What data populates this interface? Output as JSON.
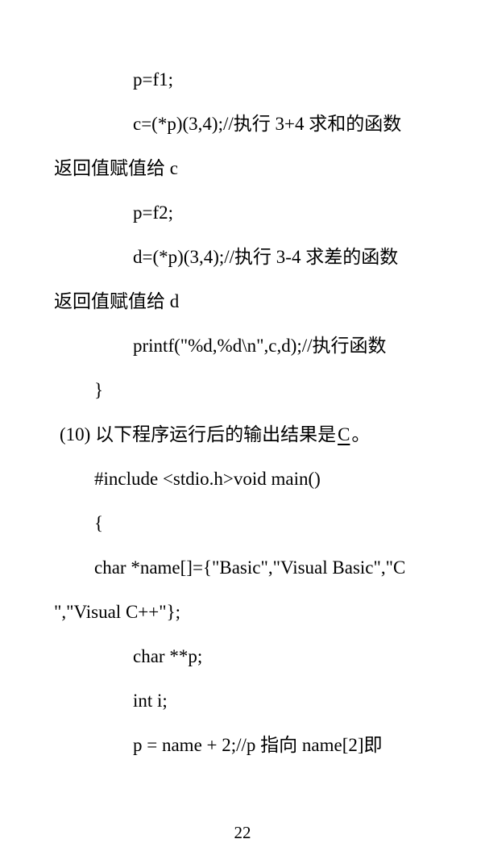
{
  "lines": [
    "p=f1;",
    "c=(*p)(3,4);//执行 3+4 求和的函数",
    "返回值赋值给 c",
    "p=f2;",
    "d=(*p)(3,4);//执行 3-4 求差的函数",
    "返回值赋值给 d",
    "printf(\"%d,%d\\n\",c,d);//执行函数",
    "}",
    "#include <stdio.h>void main()",
    "{",
    "char *name[]={\"Basic\",\"Visual Basic\",\"C",
    "\",\"Visual C++\"};",
    "char **p;",
    "int i;",
    "p = name + 2;//p 指向 name[2]即"
  ],
  "question": {
    "prefix": "(10)  以下程序运行后的输出结果是",
    "answer": "  C  ",
    "suffix": "。"
  },
  "page_number": "22"
}
